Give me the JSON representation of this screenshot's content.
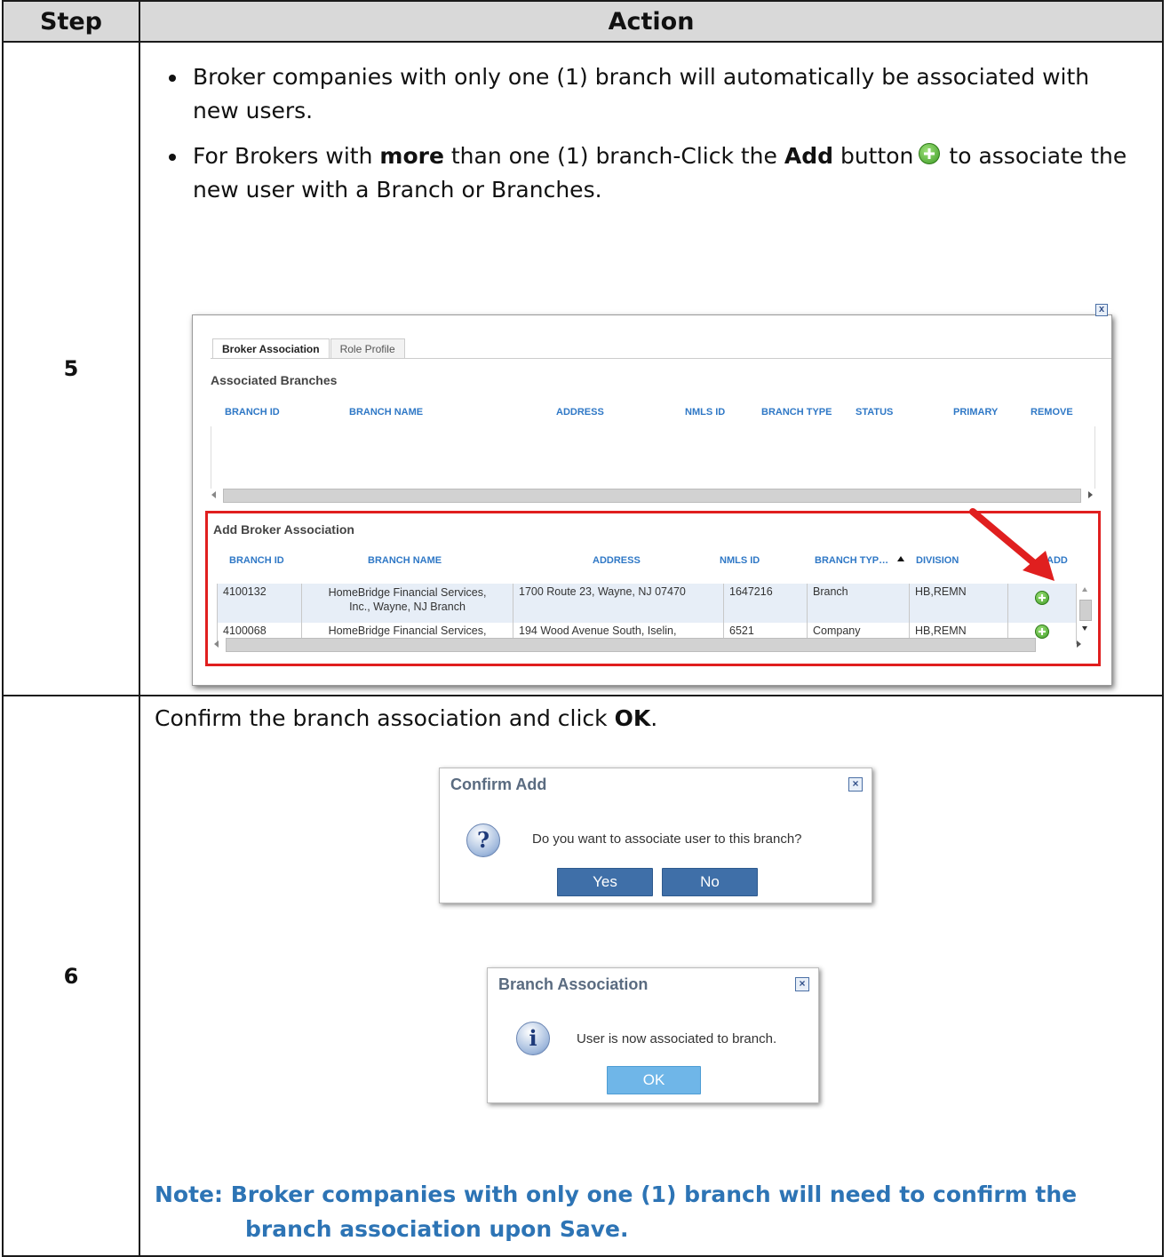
{
  "table": {
    "header_step": "Step",
    "header_action": "Action"
  },
  "step5": {
    "number": "5",
    "bullet1": "Broker companies with only one (1) branch will automatically be associated with new users.",
    "bullet2_a": "For Brokers with ",
    "bullet2_bold1": "more",
    "bullet2_b": " than one (1) branch-Click the ",
    "bullet2_bold2": "Add",
    "bullet2_c": " button",
    "bullet2_d": "to associate the new user with a Branch or Branches.",
    "screenshot": {
      "close": "x",
      "tabs": [
        "Broker Association",
        "Role Profile"
      ],
      "associated_title": "Associated Branches",
      "associated_headers": [
        "BRANCH ID",
        "BRANCH NAME",
        "ADDRESS",
        "NMLS ID",
        "BRANCH TYPE",
        "STATUS",
        "PRIMARY",
        "REMOVE"
      ],
      "add_title": "Add Broker Association",
      "add_headers": [
        "BRANCH ID",
        "BRANCH NAME",
        "ADDRESS",
        "NMLS ID",
        "BRANCH TYP…",
        "DIVISION",
        "ADD"
      ],
      "rows": [
        {
          "id": "4100132",
          "name1": "HomeBridge Financial Services,",
          "name2": "Inc., Wayne, NJ Branch",
          "address": "1700 Route 23, Wayne, NJ 07470",
          "nmls": "1647216",
          "type": "Branch",
          "division": "HB,REMN"
        },
        {
          "id": "4100068",
          "name1": "HomeBridge Financial Services,",
          "name2": "",
          "address": "194 Wood Avenue South, Iselin,",
          "nmls": "6521",
          "type": "Company",
          "division": "HB,REMN"
        }
      ]
    }
  },
  "step6": {
    "number": "6",
    "intro_a": "Confirm the branch association and click ",
    "intro_bold": "OK",
    "intro_b": ".",
    "confirm": {
      "title": "Confirm Add",
      "message": "Do you want to associate user to this branch?",
      "yes": "Yes",
      "no": "No"
    },
    "info": {
      "title": "Branch Association",
      "message": "User is now associated to branch.",
      "ok": "OK"
    },
    "note_line1": "Note:  Broker companies with only one (1) branch will need to confirm the",
    "note_line2": "branch association upon Save."
  },
  "colors": {
    "accent_blue": "#2d74b5",
    "highlight_red": "#e01f1f",
    "header_bg": "#d9d9d9"
  }
}
